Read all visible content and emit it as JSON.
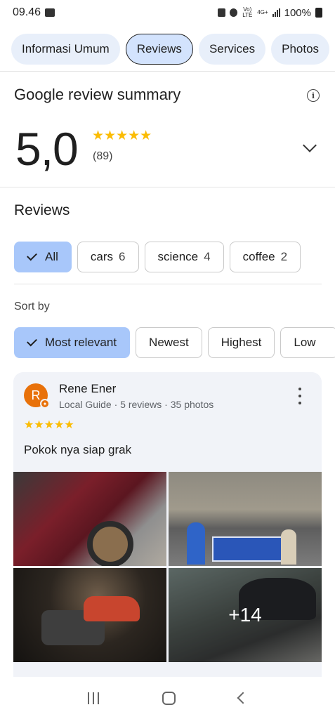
{
  "status_bar": {
    "time": "09.46",
    "network": "4G+",
    "volte": "Vo) LTE",
    "battery": "100%"
  },
  "tabs": [
    {
      "label": "Informasi Umum",
      "active": false
    },
    {
      "label": "Reviews",
      "active": true
    },
    {
      "label": "Services",
      "active": false
    },
    {
      "label": "Photos",
      "active": false
    }
  ],
  "summary": {
    "title": "Google review summary",
    "rating": "5,0",
    "stars": "★★★★★",
    "count": "(89)"
  },
  "reviews": {
    "heading": "Reviews",
    "topics": [
      {
        "label": "All",
        "count": "",
        "active": true
      },
      {
        "label": "cars",
        "count": "6",
        "active": false
      },
      {
        "label": "science",
        "count": "4",
        "active": false
      },
      {
        "label": "coffee",
        "count": "2",
        "active": false
      }
    ],
    "sort_label": "Sort by",
    "sort_options": [
      {
        "label": "Most relevant",
        "active": true
      },
      {
        "label": "Newest",
        "active": false
      },
      {
        "label": "Highest",
        "active": false
      },
      {
        "label": "Low",
        "active": false
      }
    ]
  },
  "review_card": {
    "avatar_letter": "R",
    "reviewer_name": "Rene Ener",
    "reviewer_meta": "Local Guide · 5 reviews · 35 photos",
    "stars": "★★★★★",
    "text": "Pokok nya siap grak",
    "more_photos": "+14"
  },
  "colors": {
    "accent_chip": "#a8c7fa",
    "tab_bg": "#e8effa",
    "star": "#fbbc04",
    "avatar": "#e8710a"
  }
}
